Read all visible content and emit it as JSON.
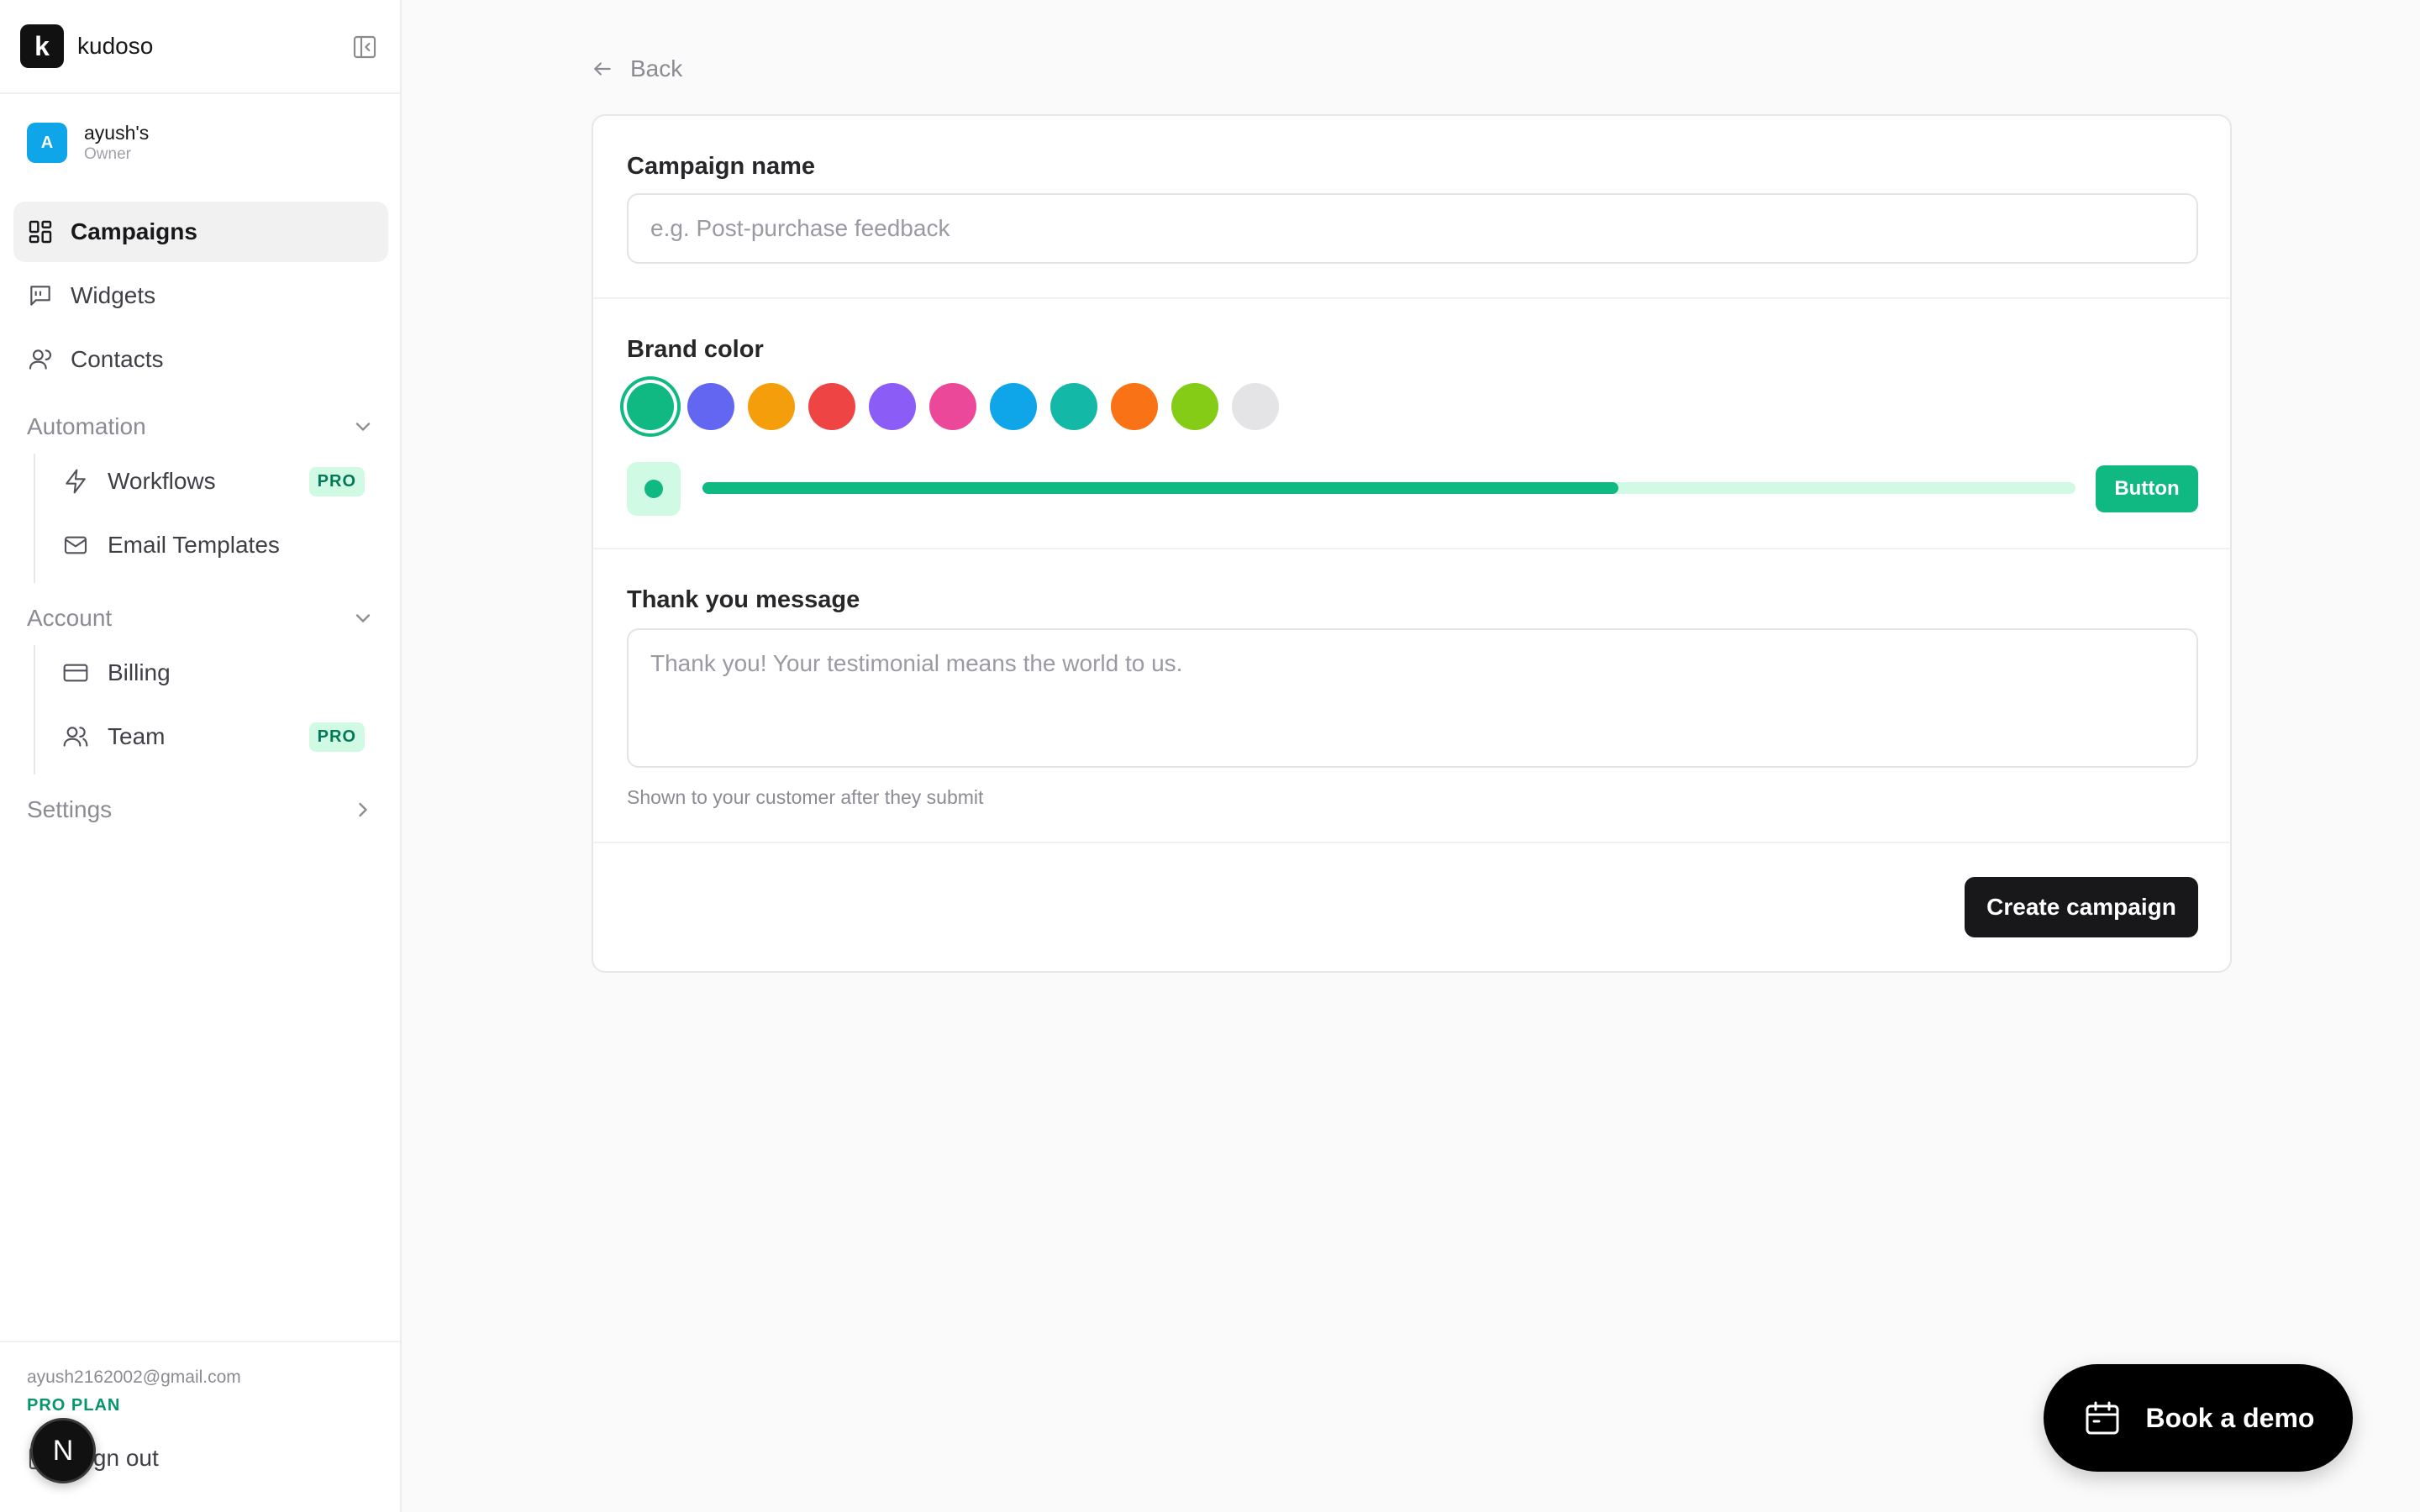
{
  "brand": {
    "logo_letter": "k",
    "name": "kudoso"
  },
  "workspace": {
    "avatar_letter": "A",
    "name": "ayush's",
    "role": "Owner"
  },
  "nav": {
    "campaigns": "Campaigns",
    "widgets": "Widgets",
    "contacts": "Contacts"
  },
  "automation": {
    "title": "Automation",
    "items": [
      {
        "label": "Workflows",
        "badge": "PRO"
      },
      {
        "label": "Email Templates"
      }
    ]
  },
  "account": {
    "title": "Account",
    "items": [
      {
        "label": "Billing"
      },
      {
        "label": "Team",
        "badge": "PRO"
      }
    ]
  },
  "settings": {
    "title": "Settings"
  },
  "footer": {
    "email": "ayush2162002@gmail.com",
    "plan": "PRO PLAN",
    "signout": "Sign out",
    "dev_badge": "N"
  },
  "main": {
    "back": "Back",
    "campaign_name_label": "Campaign name",
    "campaign_name_placeholder": "e.g. Post-purchase feedback",
    "campaign_name_value": "",
    "brand_color_label": "Brand color",
    "brand_colors": [
      "#10b981",
      "#6366f1",
      "#f59e0b",
      "#ef4444",
      "#8b5cf6",
      "#ec4899",
      "#0ea5e9",
      "#14b8a6",
      "#f97316",
      "#84cc16",
      "#e4e4e7"
    ],
    "selected_color": "#10b981",
    "preview_progress": 0.667,
    "preview_button": "Button",
    "thank_you_label": "Thank you message",
    "thank_you_placeholder": "Thank you! Your testimonial means the world to us.",
    "thank_you_helper": "Shown to your customer after they submit",
    "create_button": "Create campaign"
  },
  "demo": {
    "label": "Book a demo"
  },
  "icons": {
    "collapse": "sidebar-collapse-icon",
    "campaigns": "layout-grid-icon",
    "widgets": "message-square-icon",
    "contacts": "user-icon",
    "workflows": "lightning-icon",
    "email_templates": "mail-icon",
    "billing": "credit-card-icon",
    "team": "users-icon",
    "signout": "logout-icon",
    "back": "arrow-left-icon",
    "demo": "calendar-icon"
  }
}
